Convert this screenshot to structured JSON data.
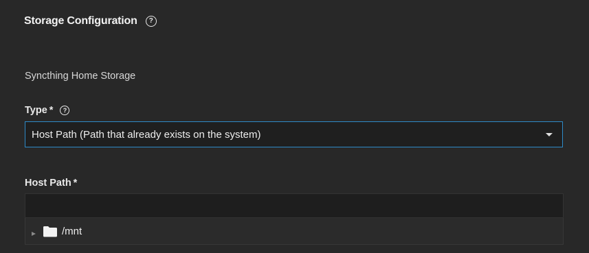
{
  "section": {
    "title": "Storage Configuration",
    "help_icon": "help-circle-icon"
  },
  "storage": {
    "subheading": "Syncthing Home Storage"
  },
  "type_field": {
    "label": "Type",
    "required_mark": "*",
    "help_icon": "help-circle-icon",
    "selected_value": "Host Path (Path that already exists on the system)",
    "caret_icon": "dropdown-caret-icon"
  },
  "host_path_field": {
    "label": "Host Path",
    "required_mark": "*",
    "value": "",
    "placeholder": ""
  },
  "explorer": {
    "nodes": [
      {
        "label": "/mnt",
        "icon": "folder-icon",
        "expand_icon": "expand-arrow-icon"
      }
    ]
  },
  "colors": {
    "background": "#282828",
    "focus_border": "#2e8bc9",
    "input_background": "#1f1f1f"
  }
}
